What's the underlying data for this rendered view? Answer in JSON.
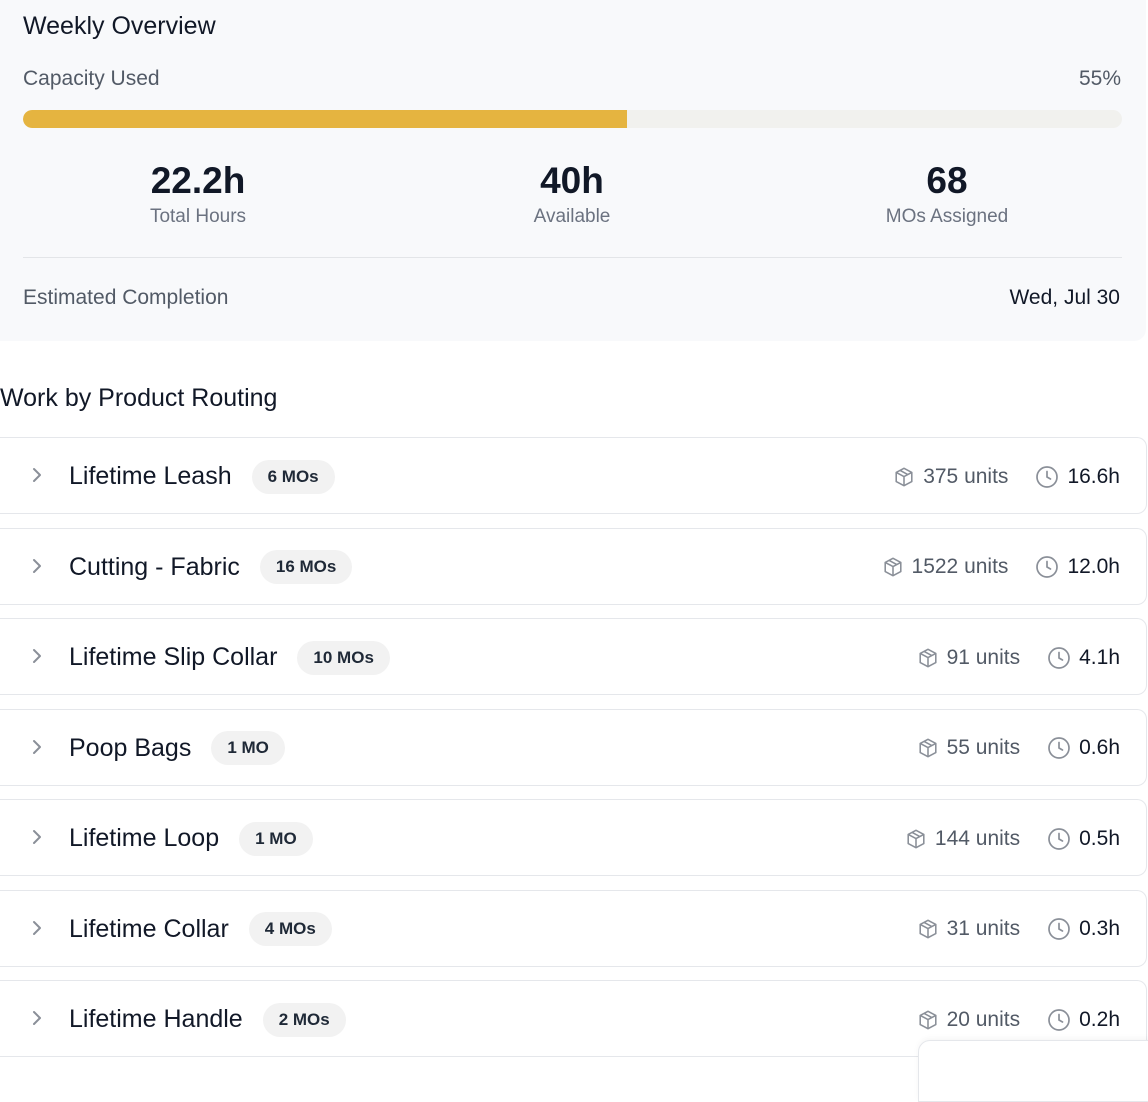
{
  "overview": {
    "title": "Weekly Overview",
    "capacity_label": "Capacity Used",
    "capacity_percent_text": "55%",
    "capacity_fraction": 0.55,
    "accent_color": "#e5b440",
    "stats": [
      {
        "value": "22.2h",
        "label": "Total Hours"
      },
      {
        "value": "40h",
        "label": "Available"
      },
      {
        "value": "68",
        "label": "MOs Assigned"
      }
    ],
    "estimated_label": "Estimated Completion",
    "estimated_value": "Wed, Jul 30"
  },
  "routing": {
    "title": "Work by Product Routing",
    "icons": {
      "expand": "chevron-right-icon",
      "units": "package-icon",
      "time": "clock-icon"
    },
    "rows": [
      {
        "name": "Lifetime Leash",
        "badge": "6 MOs",
        "units": "375 units",
        "hours": "16.6h"
      },
      {
        "name": "Cutting - Fabric",
        "badge": "16 MOs",
        "units": "1522 units",
        "hours": "12.0h"
      },
      {
        "name": "Lifetime Slip Collar",
        "badge": "10 MOs",
        "units": "91 units",
        "hours": "4.1h"
      },
      {
        "name": "Poop Bags",
        "badge": "1 MO",
        "units": "55 units",
        "hours": "0.6h"
      },
      {
        "name": "Lifetime Loop",
        "badge": "1 MO",
        "units": "144 units",
        "hours": "0.5h"
      },
      {
        "name": "Lifetime Collar",
        "badge": "4 MOs",
        "units": "31 units",
        "hours": "0.3h"
      },
      {
        "name": "Lifetime Handle",
        "badge": "2 MOs",
        "units": "20 units",
        "hours": "0.2h"
      }
    ]
  }
}
